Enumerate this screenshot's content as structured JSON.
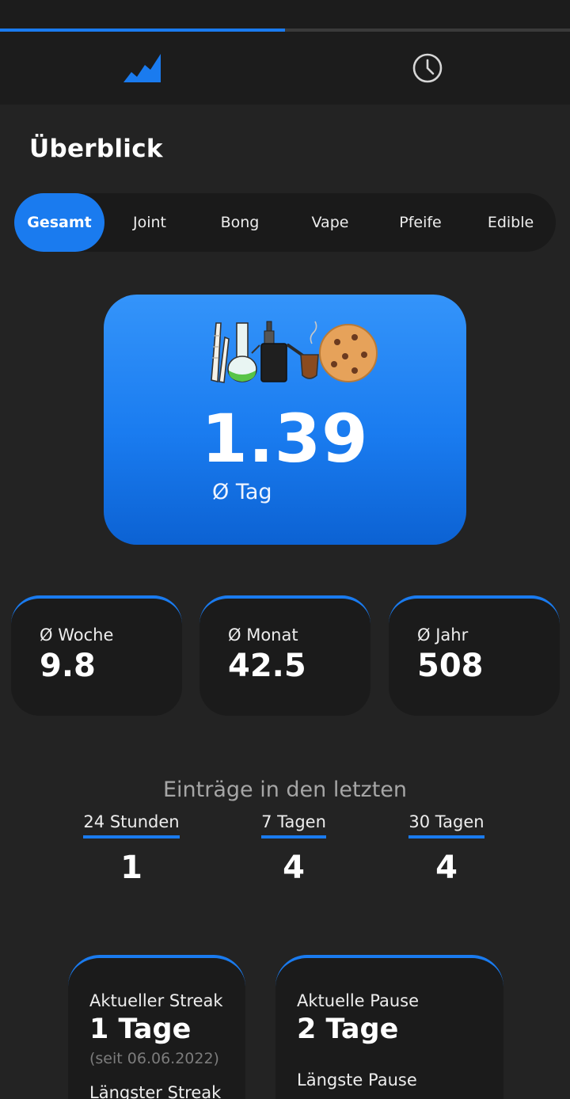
{
  "colors": {
    "accent": "#1a7bef",
    "background": "#232323",
    "card": "#1b1b1b"
  },
  "tabs": [
    {
      "name": "statistics",
      "icon": "area-chart-icon",
      "active": true
    },
    {
      "name": "history",
      "icon": "clock-icon",
      "active": false
    }
  ],
  "tab_progress_fraction": 0.5,
  "section_title": "Überblick",
  "filters": [
    {
      "label": "Gesamt",
      "active": true
    },
    {
      "label": "Joint",
      "active": false
    },
    {
      "label": "Bong",
      "active": false
    },
    {
      "label": "Vape",
      "active": false
    },
    {
      "label": "Pfeife",
      "active": false
    },
    {
      "label": "Edible",
      "active": false
    }
  ],
  "hero": {
    "icons": [
      "joint-icon",
      "bong-icon",
      "vape-icon",
      "pipe-icon",
      "cookie-icon"
    ],
    "value": "1.39",
    "label": "Ø Tag"
  },
  "averages": [
    {
      "label": "Ø Woche",
      "value": "9.8"
    },
    {
      "label": "Ø Monat",
      "value": "42.5"
    },
    {
      "label": "Ø Jahr",
      "value": "508"
    }
  ],
  "entries": {
    "title": "Einträge in den letzten",
    "periods": [
      {
        "label": "24 Stunden",
        "value": "1"
      },
      {
        "label": "7 Tagen",
        "value": "4"
      },
      {
        "label": "30 Tagen",
        "value": "4"
      }
    ]
  },
  "streak": {
    "current_label": "Aktueller Streak",
    "current_value": "1 Tage",
    "since": "(seit 06.06.2022)",
    "longest_label": "Längster Streak"
  },
  "pause": {
    "current_label": "Aktuelle Pause",
    "current_value": "2 Tage",
    "longest_label": "Längste Pause"
  }
}
